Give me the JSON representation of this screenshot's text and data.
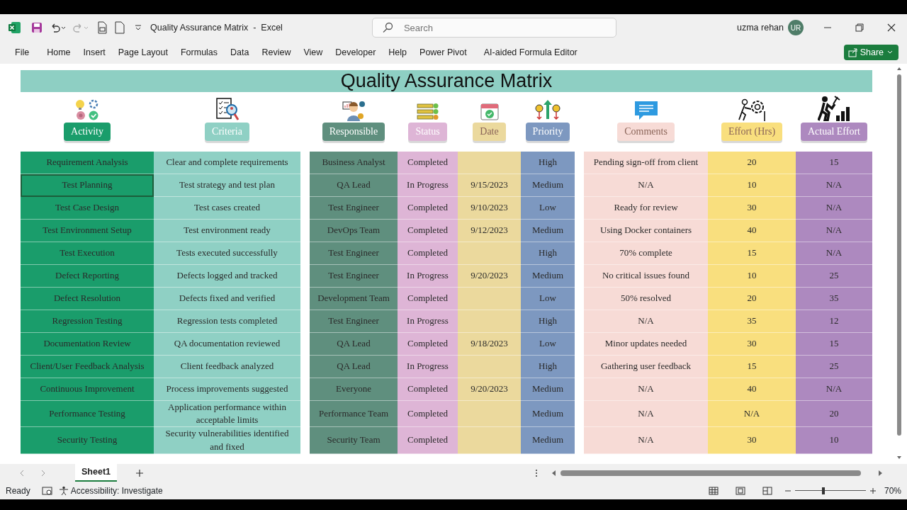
{
  "window": {
    "title": "Quality Assurance Matrix  -  Excel",
    "search_placeholder": "Search",
    "user": "uzma rehan",
    "avatar": "UR"
  },
  "ribbon_tabs": [
    {
      "label": "File"
    },
    {
      "label": "Home"
    },
    {
      "label": "Insert"
    },
    {
      "label": "Page Layout"
    },
    {
      "label": "Formulas"
    },
    {
      "label": "Data"
    },
    {
      "label": "Review"
    },
    {
      "label": "View"
    },
    {
      "label": "Developer"
    },
    {
      "label": "Help"
    },
    {
      "label": "Power Pivot"
    },
    {
      "label": "AI-aided Formula Editor"
    }
  ],
  "share_button": "Share",
  "sheet": {
    "title": "Quality Assurance Matrix",
    "column_groups": [
      {
        "columns": [
          {
            "label": "Activity",
            "color": "#1a9d6b"
          },
          {
            "label": "Criteria",
            "color": "#8fd0c4"
          }
        ]
      },
      {
        "columns": [
          {
            "label": "Responsible",
            "color": "#5f8f7e"
          },
          {
            "label": "Status",
            "color": "#deb5d6"
          },
          {
            "label": "Date",
            "color": "#ebd99d"
          },
          {
            "label": "Priority",
            "color": "#7d98c0"
          }
        ]
      },
      {
        "columns": [
          {
            "label": "Comments",
            "color": "#f7dbd6"
          },
          {
            "label": "Effort (Hrs)",
            "color": "#f9df7e"
          },
          {
            "label": "Actual Effort",
            "color": "#ad89bf"
          }
        ]
      }
    ],
    "rows": [
      {
        "selected": false,
        "cells": [
          "Requirement Analysis",
          "Clear and complete requirements",
          "Business Analyst",
          "Completed",
          null,
          "High",
          "Pending sign-off from client",
          "20",
          "15"
        ]
      },
      {
        "selected": true,
        "cells": [
          "Test Planning",
          "Test strategy and test plan",
          "QA Lead",
          "In Progress",
          "9/15/2023",
          "Medium",
          "N/A",
          "10",
          "N/A"
        ]
      },
      {
        "selected": false,
        "cells": [
          "Test Case Design",
          "Test cases created",
          "Test Engineer",
          "Completed",
          "9/10/2023",
          "Low",
          "Ready for review",
          "30",
          "N/A"
        ]
      },
      {
        "selected": false,
        "cells": [
          "Test Environment Setup",
          "Test environment ready",
          "DevOps Team",
          "Completed",
          "9/12/2023",
          "Medium",
          "Using Docker containers",
          "40",
          "N/A"
        ]
      },
      {
        "selected": false,
        "cells": [
          "Test Execution",
          "Tests executed successfully",
          "Test Engineer",
          "Completed",
          null,
          "High",
          "70% complete",
          "15",
          "N/A"
        ]
      },
      {
        "selected": false,
        "cells": [
          "Defect Reporting",
          "Defects logged and tracked",
          "Test Engineer",
          "In Progress",
          "9/20/2023",
          "Medium",
          "No critical issues found",
          "10",
          "25"
        ]
      },
      {
        "selected": false,
        "cells": [
          "Defect Resolution",
          "Defects fixed and verified",
          "Development Team",
          "Completed",
          null,
          "Low",
          "50% resolved",
          "20",
          "35"
        ]
      },
      {
        "selected": false,
        "cells": [
          "Regression Testing",
          "Regression tests completed",
          "Test Engineer",
          "In Progress",
          null,
          "High",
          "N/A",
          "35",
          "12"
        ]
      },
      {
        "selected": false,
        "cells": [
          "Documentation Review",
          "QA documentation reviewed",
          "QA Lead",
          "Completed",
          "9/18/2023",
          "Low",
          "Minor updates needed",
          "30",
          "15"
        ]
      },
      {
        "selected": false,
        "cells": [
          "Client/User Feedback Analysis",
          "Client feedback analyzed",
          "QA Lead",
          "In Progress",
          null,
          "High",
          "Gathering user feedback",
          "15",
          "25"
        ]
      },
      {
        "selected": false,
        "cells": [
          "Continuous Improvement",
          "Process improvements suggested",
          "Everyone",
          "Completed",
          "9/20/2023",
          "Medium",
          "N/A",
          "40",
          "N/A"
        ]
      },
      {
        "selected": false,
        "cells": [
          "Performance Testing",
          "Application performance within acceptable limits",
          "Performance Team",
          "Completed",
          null,
          "Medium",
          "N/A",
          "N/A",
          "20"
        ]
      },
      {
        "selected": false,
        "cells": [
          "Security Testing",
          "Security vulnerabilities identified and fixed",
          "Security Team",
          "Completed",
          null,
          "Medium",
          "N/A",
          "30",
          "10"
        ]
      }
    ]
  },
  "sheet_tabs": [
    {
      "label": "Sheet1",
      "selected": true
    }
  ],
  "status_bar": {
    "mode": "Ready",
    "accessibility": "Accessibility: Investigate",
    "zoom": "70%",
    "zoom_slider": {
      "level": 0.4
    }
  }
}
